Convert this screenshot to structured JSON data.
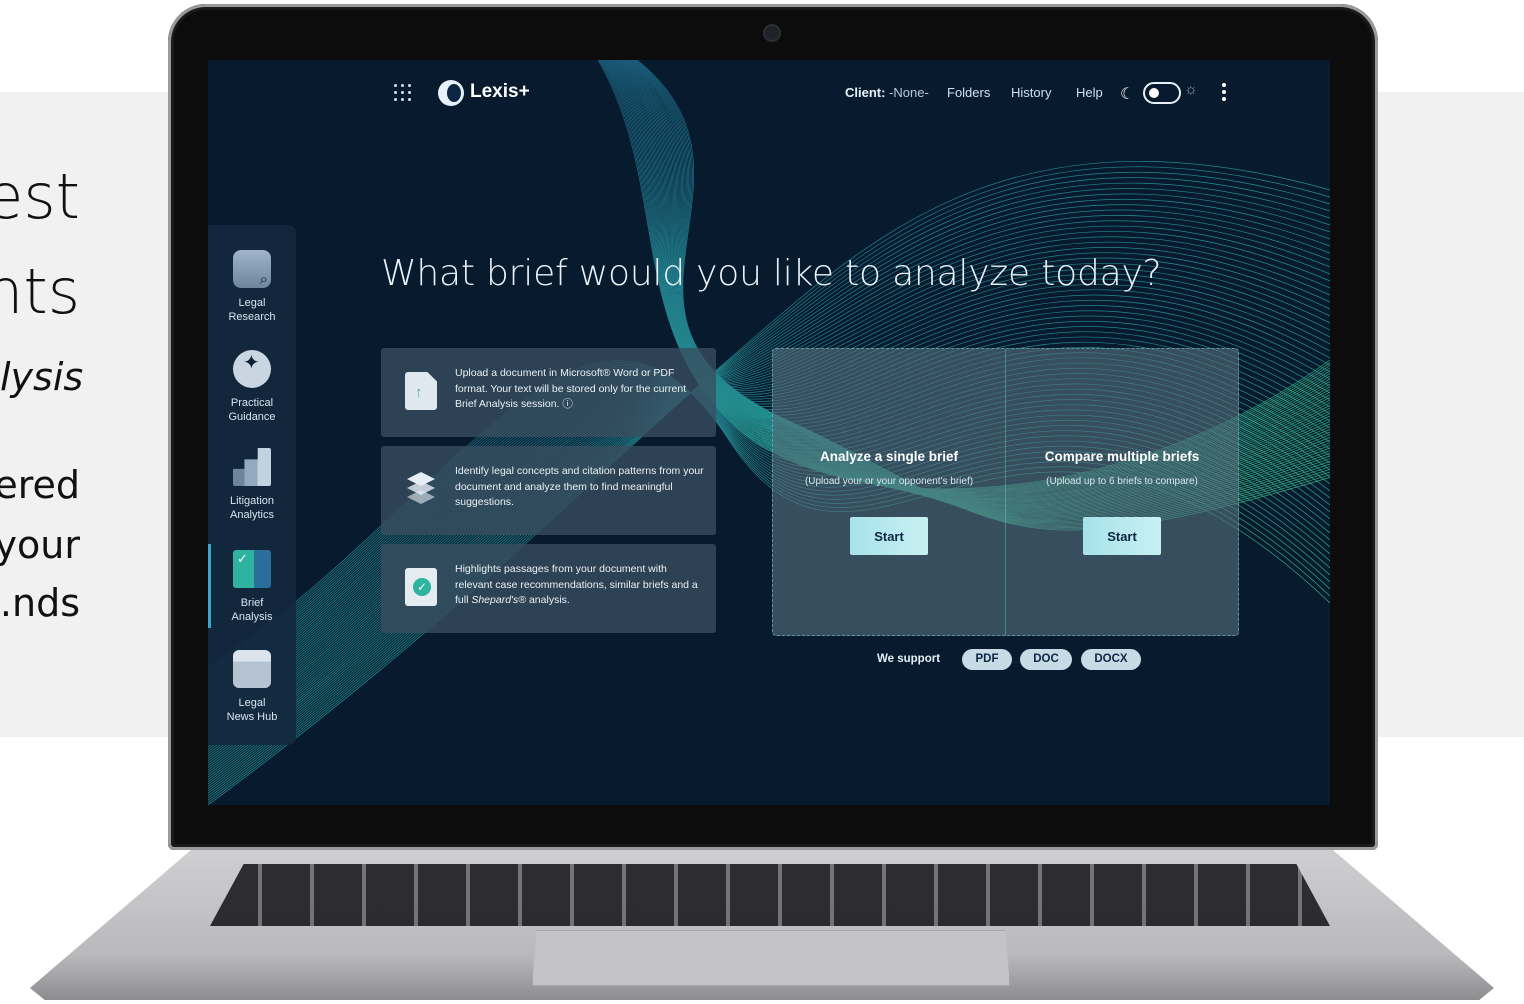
{
  "background_text": {
    "line1": "est",
    "line2": "nts",
    "line3": "lysis",
    "line4": "ered",
    "line5": "your",
    "line6": "nds."
  },
  "topbar": {
    "brand": "Lexis+",
    "client_label": "Client:",
    "client_value": "-None-",
    "folders": "Folders",
    "history": "History",
    "help": "Help"
  },
  "sidebar": {
    "items": [
      {
        "line1": "Legal",
        "line2": "Research"
      },
      {
        "line1": "Practical",
        "line2": "Guidance"
      },
      {
        "line1": "Litigation",
        "line2": "Analytics"
      },
      {
        "line1": "Brief",
        "line2": "Analysis"
      },
      {
        "line1": "Legal",
        "line2": "News Hub"
      }
    ],
    "active_index": 3
  },
  "main": {
    "headline": "What brief would you like to analyze today?",
    "features": [
      {
        "text": "Upload a document in Microsoft® Word or PDF format. Your text will be stored only for the current Brief Analysis session. ⓘ"
      },
      {
        "text": "Identify legal concepts and citation patterns from your document and analyze them to find meaningful suggestions."
      },
      {
        "text_before": "Highlights passages from your document with relevant case recommendations, similar briefs and a full ",
        "text_italic": "Shepard's®",
        "text_after": " analysis."
      }
    ],
    "actions": {
      "single": {
        "title": "Analyze a single brief",
        "subtitle": "(Upload your or your opponent's brief)",
        "button": "Start"
      },
      "multiple": {
        "title": "Compare multiple briefs",
        "subtitle": "(Upload up to 6 briefs to compare)",
        "button": "Start"
      }
    },
    "support": {
      "label": "We support",
      "formats": [
        "PDF",
        "DOC",
        "DOCX"
      ]
    }
  },
  "colors": {
    "screen_bg": "#071a2e",
    "accent": "#2db3a0",
    "button": "#b8e9ee"
  }
}
